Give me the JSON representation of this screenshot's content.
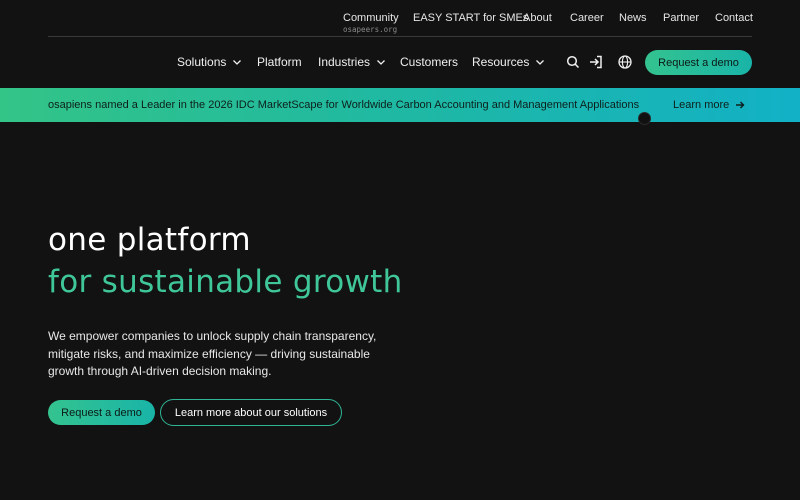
{
  "utility_nav": {
    "community": "Community",
    "community_sub": "osapeers.org",
    "easy_start": "EASY START for SMEs",
    "about": "About",
    "career": "Career",
    "news": "News",
    "partner": "Partner",
    "contact": "Contact"
  },
  "main_nav": {
    "solutions": "Solutions",
    "platform": "Platform",
    "industries": "Industries",
    "customers": "Customers",
    "resources": "Resources",
    "request_demo": "Request a demo",
    "icons": [
      "search-icon",
      "login-icon",
      "globe-icon",
      "chevron-down-icon"
    ]
  },
  "banner": {
    "text": "osapiens named a Leader in the 2026 IDC MarketScape for Worldwide Carbon Accounting and Management Applications",
    "link": "Learn more"
  },
  "hero": {
    "headline_1": "one platform",
    "headline_2": "for sustainable growth",
    "description": "We empower companies to unlock supply chain transparency, mitigate risks, and maximize efficiency — driving sustainable growth through AI-driven decision making.",
    "cta_primary": "Request a demo",
    "cta_secondary": "Learn more about our solutions"
  },
  "colors": {
    "background": "#121212",
    "accent_green": "#3fc79a",
    "gradient_start": "#33c487",
    "gradient_end": "#12b1c6"
  }
}
